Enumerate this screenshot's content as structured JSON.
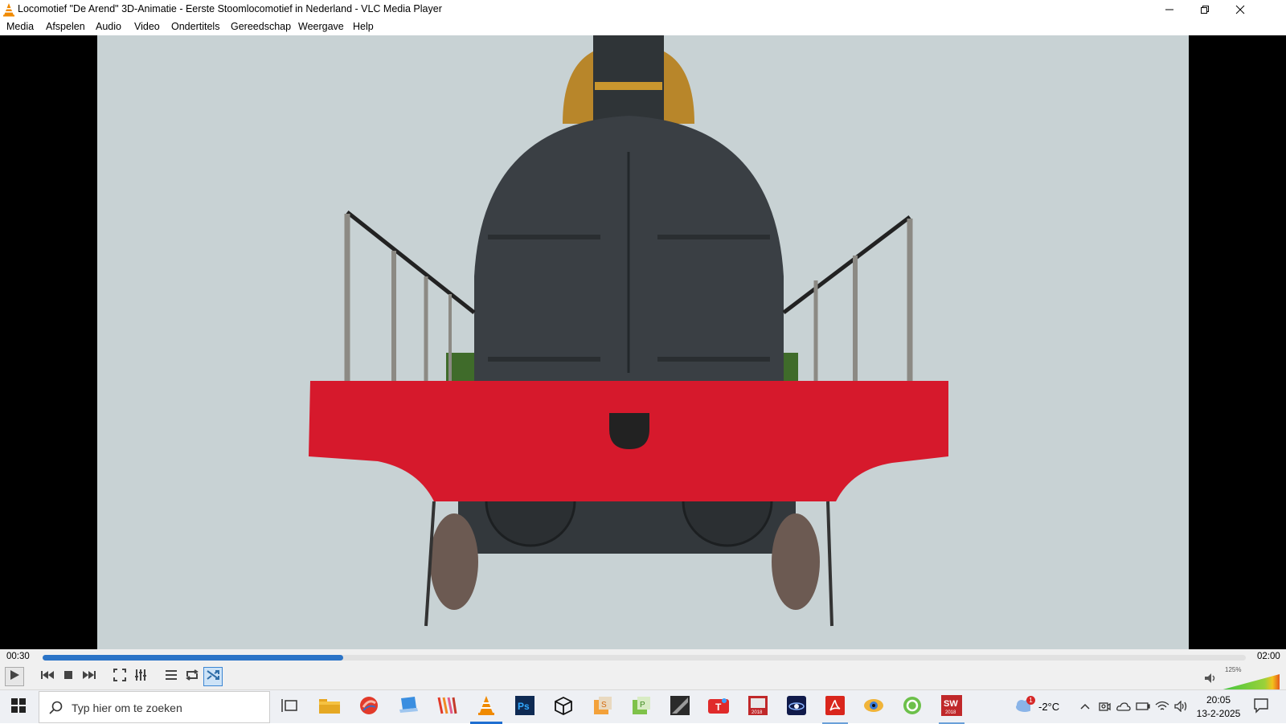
{
  "window": {
    "title": "Locomotief \"De Arend\" 3D-Animatie - Eerste Stoomlocomotief in Nederland - VLC Media Player",
    "icon": "vlc-cone-icon"
  },
  "menubar": {
    "items": [
      "Media",
      "Afspelen",
      "Audio",
      "Video",
      "Ondertitels",
      "Gereedschap",
      "Weergave",
      "Help"
    ]
  },
  "playback": {
    "elapsed": "00:30",
    "total": "02:00",
    "progress": 0.25,
    "volume_label": "125%",
    "volume_level": 1.25
  },
  "controls": {
    "buttons": [
      "play-icon",
      "previous-icon",
      "stop-icon",
      "next-icon",
      "fullscreen-icon",
      "extended-settings-icon",
      "playlist-icon",
      "loop-icon",
      "shuffle-icon"
    ],
    "shuffle_active": true
  },
  "taskbar": {
    "search_placeholder": "Typ hier om te zoeken",
    "weather": "-2°C",
    "weather_badge": "1",
    "time": "20:05",
    "date": "13-2-2025",
    "apps": [
      "task-view",
      "file-explorer",
      "app-red",
      "app-blue-laptop",
      "app-colorful",
      "vlc",
      "photoshop",
      "app-box",
      "app-orange",
      "app-green",
      "app-dark",
      "app-red-t",
      "solidworks-red-2018",
      "app-galaxy",
      "acrobat",
      "app-eye",
      "app-green-circle",
      "solidworks-2018"
    ]
  },
  "colors": {
    "accent": "#2b74c7",
    "video_bg": "#c8d2d4",
    "buffer_red": "#d6192c"
  }
}
